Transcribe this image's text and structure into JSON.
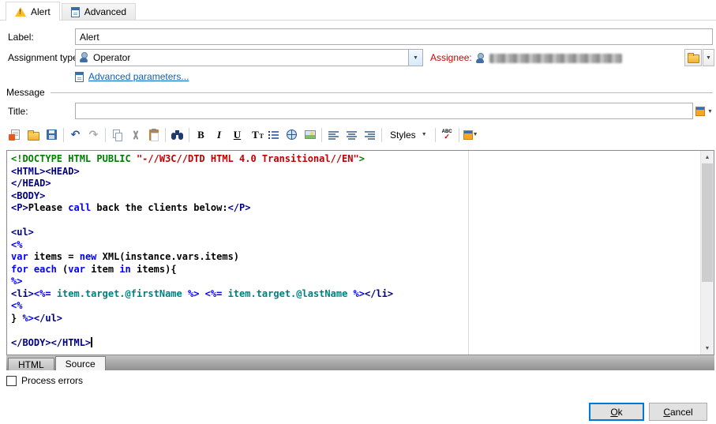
{
  "tabs": [
    {
      "label": "Alert",
      "active": true
    },
    {
      "label": "Advanced",
      "active": false
    }
  ],
  "form": {
    "label": {
      "caption": "Label:",
      "value": "Alert"
    },
    "assignment": {
      "caption": "Assignment type:",
      "value": "Operator"
    },
    "assignee": {
      "caption": "Assignee:"
    },
    "advanced_link": "Advanced parameters...",
    "group": "Message",
    "title_caption": "Title:",
    "title_value": ""
  },
  "toolbar": {
    "styles_label": "Styles",
    "groups": [
      [
        "insert-html",
        "open-folder",
        "save"
      ],
      [
        "undo",
        "redo"
      ],
      [
        "copy",
        "cut",
        "paste"
      ],
      [
        "find"
      ],
      [
        "bold",
        "italic",
        "underline",
        "text-size",
        "bullet-list",
        "link",
        "image"
      ],
      [
        "align-left",
        "align-center",
        "align-right"
      ],
      [
        "styles"
      ],
      [
        "spellcheck"
      ],
      [
        "insert-field"
      ]
    ]
  },
  "icon_glyphs": {
    "dropdown": "▼",
    "arrow_up": "▲",
    "arrow_down": "▼",
    "undo": "↶",
    "redo": "↷",
    "bold": "B",
    "italic": "I",
    "underline": "U",
    "text-size": "T",
    "spell_abc": "ABC",
    "check": "✓"
  },
  "editor": {
    "colors": {
      "tag": "#000080",
      "kw": "#0000ff",
      "str": "#c00000",
      "dir": "#008000",
      "txt": "#000000",
      "expr": "#008080"
    },
    "caret_line": 15,
    "lines": [
      [
        [
          "dir",
          "<!DOCTYPE HTML PUBLIC "
        ],
        [
          "str",
          "\"-//W3C//DTD HTML 4.0 Transitional//EN\""
        ],
        [
          "dir",
          ">"
        ]
      ],
      [
        [
          "tag",
          "<HTML><HEAD>"
        ]
      ],
      [
        [
          "tag",
          "</HEAD>"
        ]
      ],
      [
        [
          "tag",
          "<BODY>"
        ]
      ],
      [
        [
          "tag",
          "<P>"
        ],
        [
          "txt",
          "Please "
        ],
        [
          "kw",
          "call"
        ],
        [
          "txt",
          " back the clients below:"
        ],
        [
          "tag",
          "</P>"
        ]
      ],
      [],
      [
        [
          "tag",
          "<ul>"
        ]
      ],
      [
        [
          "kw",
          "<%"
        ]
      ],
      [
        [
          "kw",
          "var"
        ],
        [
          "txt",
          " items = "
        ],
        [
          "kw",
          "new"
        ],
        [
          "txt",
          " XML(instance.vars.items)"
        ]
      ],
      [
        [
          "kw",
          "for"
        ],
        [
          "txt",
          " "
        ],
        [
          "kw",
          "each"
        ],
        [
          "txt",
          " ("
        ],
        [
          "kw",
          "var"
        ],
        [
          "txt",
          " item "
        ],
        [
          "kw",
          "in"
        ],
        [
          "txt",
          " items){"
        ]
      ],
      [
        [
          "kw",
          "%>"
        ]
      ],
      [
        [
          "tag",
          "<li>"
        ],
        [
          "kw",
          "<%="
        ],
        [
          "expr",
          " item.target.@firstName "
        ],
        [
          "kw",
          "%>"
        ],
        [
          "txt",
          " "
        ],
        [
          "kw",
          "<%="
        ],
        [
          "expr",
          " item.target.@lastName "
        ],
        [
          "kw",
          "%>"
        ],
        [
          "tag",
          "</li>"
        ]
      ],
      [
        [
          "kw",
          "<%"
        ]
      ],
      [
        [
          "txt",
          "} "
        ],
        [
          "kw",
          "%>"
        ],
        [
          "tag",
          "</ul>"
        ]
      ],
      [],
      [
        [
          "tag",
          "</BODY></HTML>"
        ]
      ]
    ]
  },
  "bottom_tabs": [
    {
      "label": "HTML",
      "active": false
    },
    {
      "label": "Source",
      "active": true
    }
  ],
  "process_errors": "Process errors",
  "buttons": {
    "ok": {
      "key": "O",
      "rest": "k"
    },
    "cancel": {
      "key": "C",
      "rest": "ancel"
    }
  },
  "colors": {
    "assignee_label": "#d00000",
    "link": "#0563c1",
    "warning": "#fdbc2c",
    "focus_border": "#0078d7"
  }
}
